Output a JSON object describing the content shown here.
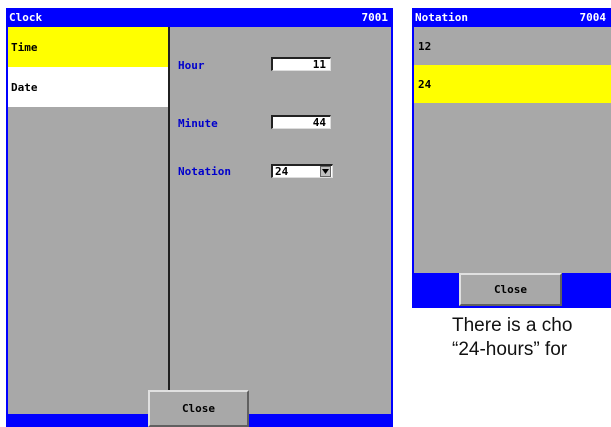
{
  "clock_window": {
    "title": "Clock",
    "code": "7001",
    "nav": [
      {
        "label": "Time",
        "selected": true
      },
      {
        "label": "Date",
        "selected": false
      }
    ],
    "fields": {
      "hour_label": "Hour",
      "hour_value": "11",
      "minute_label": "Minute",
      "minute_value": "44",
      "notation_label": "Notation",
      "notation_value": "24"
    },
    "close_label": "Close"
  },
  "notation_window": {
    "title": "Notation",
    "code": "7004",
    "options": [
      {
        "label": "12",
        "selected": false
      },
      {
        "label": "24",
        "selected": true
      }
    ],
    "close_label": "Close"
  },
  "caption": {
    "line1": "There is a cho",
    "line2": "“24-hours” for"
  },
  "colors": {
    "titlebar": "#0000ff",
    "panel": "#a8a8a8",
    "selection": "#ffff00",
    "label_blue": "#0000cc"
  }
}
